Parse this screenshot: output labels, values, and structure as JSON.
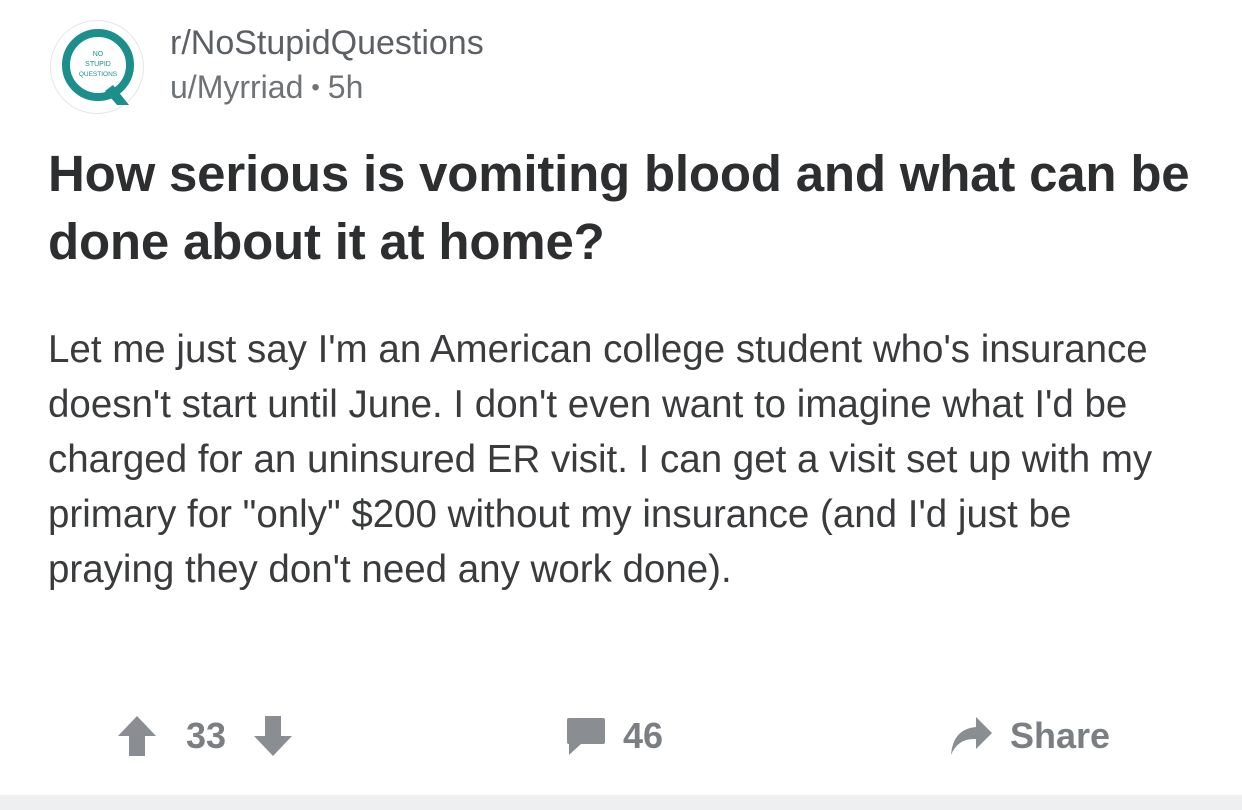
{
  "post": {
    "subreddit": "r/NoStupidQuestions",
    "author": "u/Myrriad",
    "separator": "•",
    "age": "5h",
    "avatar_text": [
      "NO",
      "STUPID",
      "QUESTIONS"
    ],
    "title": "How serious is vomiting blood and what can be done about it at home?",
    "body": "Let me just say I'm an American college student who's insurance doesn't start until June. I don't even want to imagine what I'd be charged for an uninsured ER visit. I can get a visit set up with my primary for \"only\" $200 without my insurance (and I'd just be praying they don't need any work done)."
  },
  "actions": {
    "score": "33",
    "comments": "46",
    "share_label": "Share"
  },
  "icons": {
    "upvote": "arrow-up-icon",
    "downvote": "arrow-down-icon",
    "comment": "comment-bubble-icon",
    "share": "share-arrow-icon"
  },
  "colors": {
    "brand_teal": "#1c8f8c",
    "icon_gray": "#8a8d91",
    "text_dark": "#2d2e30"
  }
}
